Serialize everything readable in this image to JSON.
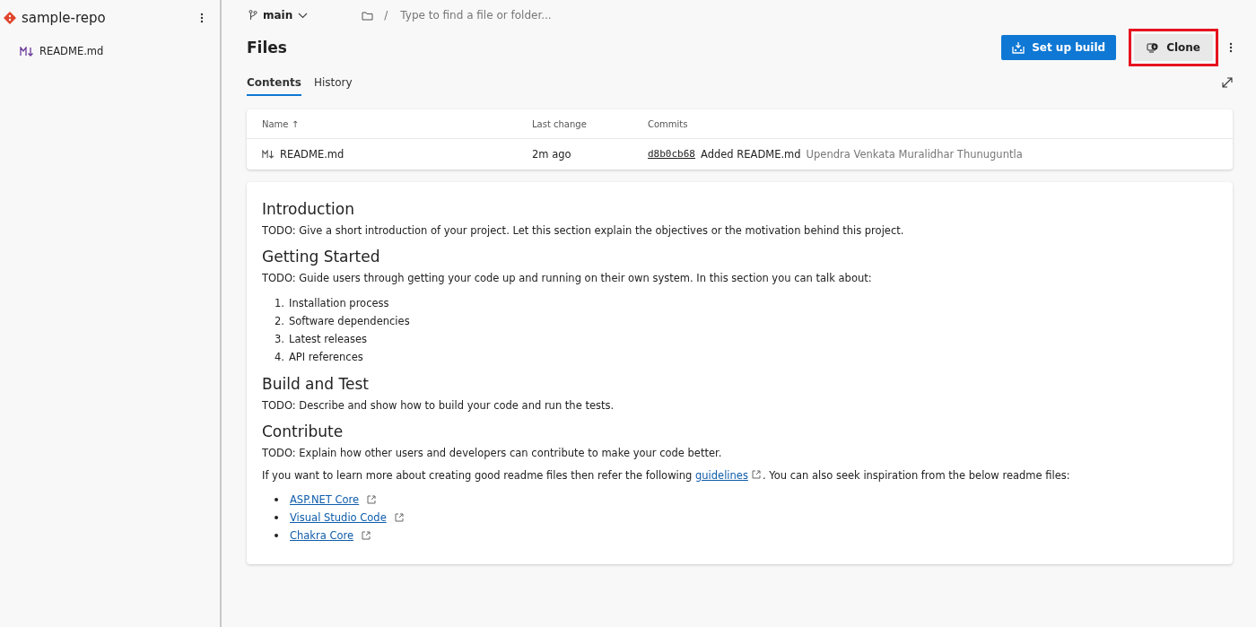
{
  "sidebar": {
    "repo_name": "sample-repo",
    "items": [
      {
        "label": "README.md",
        "selected": false
      }
    ]
  },
  "toolbar": {
    "branch": "main",
    "path_separator": "/",
    "search": {
      "placeholder": "Type to find a file or folder..."
    }
  },
  "header": {
    "title": "Files",
    "buttons": [
      {
        "label": "Set up build",
        "kind": "primary",
        "highlighted": false
      },
      {
        "label": "Clone",
        "kind": "secondary",
        "highlighted": true
      }
    ]
  },
  "tabs": [
    {
      "label": "Contents",
      "selected": true
    },
    {
      "label": "History",
      "selected": false
    }
  ],
  "table": {
    "columns": [
      {
        "label": "Name",
        "sort": "↑"
      },
      {
        "label": "Last change"
      },
      {
        "label": "Commits"
      }
    ],
    "rows": [
      {
        "name": "README.md",
        "last_change": "2m ago",
        "commit_id": "d8b0cb68",
        "message": "Added README.md",
        "author": "Upendra Venkata Muralidhar Thunuguntla"
      }
    ]
  },
  "readme": {
    "sections": [
      {
        "heading": "Introduction",
        "text": "TODO: Give a short introduction of your project. Let this section explain the objectives or the motivation behind this project."
      },
      {
        "heading": "Getting Started",
        "text": "TODO: Guide users through getting your code up and running on their own system. In this section you can talk about:",
        "list": [
          {
            "number": "1.",
            "text": "Installation process"
          },
          {
            "number": "2.",
            "text": "Software dependencies"
          },
          {
            "number": "3.",
            "text": "Latest releases"
          },
          {
            "number": "4.",
            "text": "API references"
          }
        ]
      },
      {
        "heading": "Build and Test",
        "text": "TODO: Describe and show how to build your code and run the tests."
      },
      {
        "heading": "Contribute",
        "text": "TODO: Explain how other users and developers can contribute to make your code better."
      }
    ],
    "closing": {
      "before": "If you want to learn more about creating good readme files then refer the following",
      "link": "guidelines",
      "after": ". You can also seek inspiration from the below readme files:"
    },
    "links": [
      "ASP.NET Core",
      "Visual Studio Code",
      "Chakra Core"
    ]
  }
}
